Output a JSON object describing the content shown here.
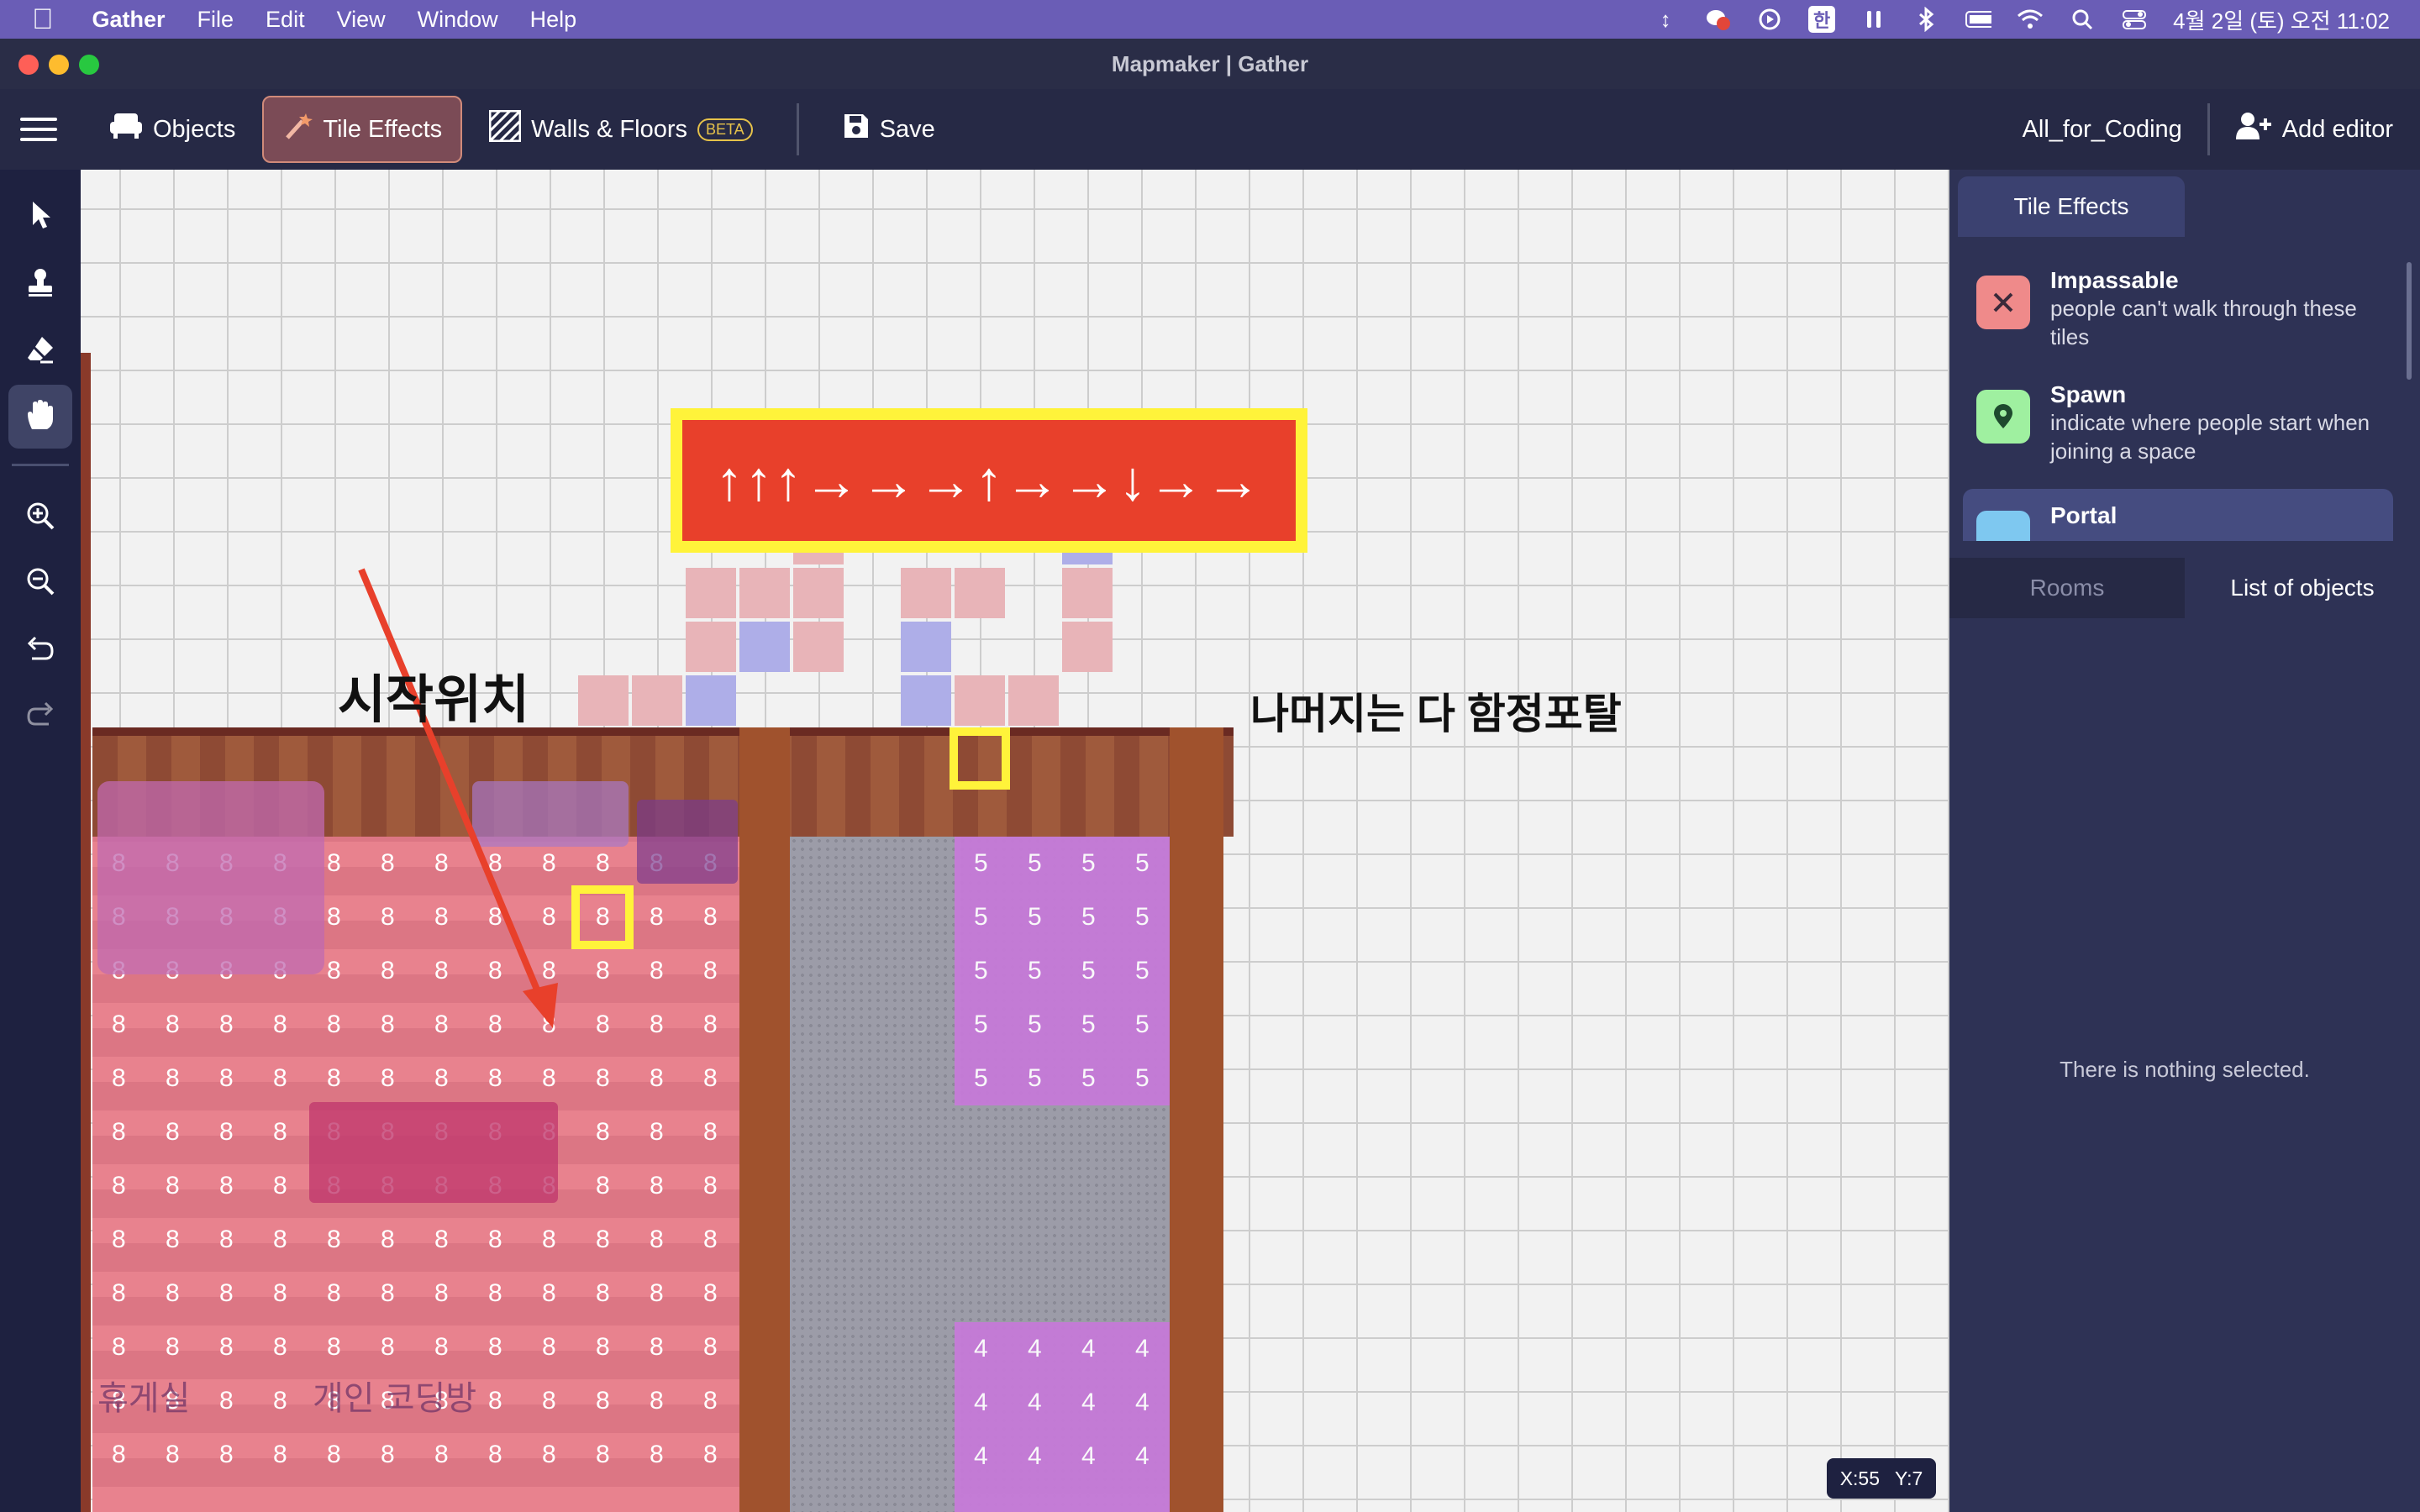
{
  "menubar": {
    "apple": "",
    "app": "Gather",
    "items": [
      "File",
      "Edit",
      "View",
      "Window",
      "Help"
    ],
    "ime": "한",
    "clock": "4월 2일 (토) 오전 11:02"
  },
  "window": {
    "title": "Mapmaker | Gather"
  },
  "toolbar": {
    "objects": "Objects",
    "tile_effects": "Tile Effects",
    "walls_floors": "Walls & Floors",
    "beta": "BETA",
    "save": "Save",
    "space_name": "All_for_Coding",
    "add_editor": "Add editor"
  },
  "panel": {
    "tab_title": "Tile Effects",
    "effects": [
      {
        "title": "Impassable",
        "desc": "people can't walk through these tiles",
        "color": "#ef8a8a"
      },
      {
        "title": "Spawn",
        "desc": "indicate where people start when joining a space",
        "color": "#9ff0a0"
      },
      {
        "title": "Portal",
        "desc": "",
        "color": "#7ec8f0"
      }
    ],
    "tab_rooms": "Rooms",
    "tab_objects": "List of objects",
    "empty": "There is nothing selected."
  },
  "annotations": {
    "start": "시작위치",
    "rest": "나머지는 다 함정포탈",
    "arrows": "↑↑↑→→→↑→→↓→→"
  },
  "map": {
    "room_label_1": "휴게실",
    "room_label_2": "개인 코딩방",
    "portal_num_a": "8",
    "portal_num_b": "5",
    "portal_num_c": "4"
  },
  "coords": {
    "x": "X:55",
    "y": "Y:7"
  }
}
